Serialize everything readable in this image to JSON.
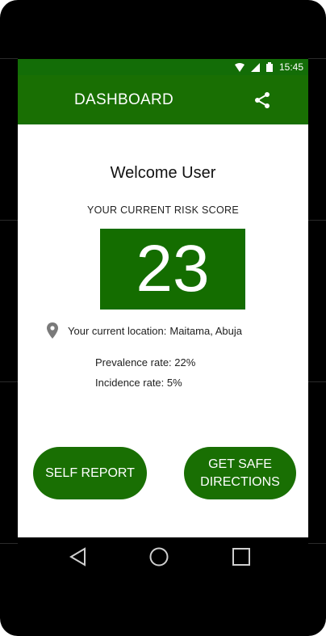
{
  "status_bar": {
    "time": "15:45",
    "icons": [
      "wifi-icon",
      "signal-icon",
      "battery-icon"
    ]
  },
  "app_bar": {
    "title": "DASHBOARD",
    "action_icon": "share-icon"
  },
  "main": {
    "welcome": "Welcome User",
    "risk_label": "YOUR CURRENT RISK SCORE",
    "risk_score": "23",
    "location_label": "Your current location:",
    "location_value": "Maitama, Abuja",
    "prevalence": "Prevalence rate: 22%",
    "incidence": "Incidence rate: 5%"
  },
  "buttons": {
    "self_report": "SELF REPORT",
    "safe_directions_line1": "GET SAFE",
    "safe_directions_line2": "DIRECTIONS"
  },
  "nav": {
    "icons": [
      "back-icon",
      "home-icon",
      "recents-icon"
    ]
  },
  "colors": {
    "primary": "#196f03",
    "status_bar": "#136d07",
    "score_bg": "#146d00"
  }
}
